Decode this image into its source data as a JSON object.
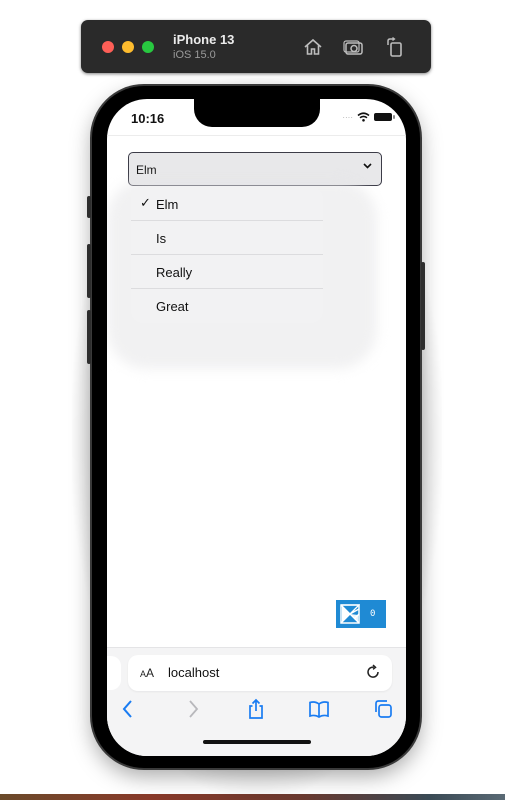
{
  "simulator": {
    "device_name": "iPhone 13",
    "os_version": "iOS 15.0",
    "buttons": [
      {
        "name": "home",
        "icon": "home-icon"
      },
      {
        "name": "screenshot",
        "icon": "camera-icon"
      },
      {
        "name": "rotate",
        "icon": "rotate-icon"
      }
    ]
  },
  "status_bar": {
    "time": "10:16",
    "signal": "····",
    "icons": [
      "wifi-icon",
      "battery-icon"
    ]
  },
  "select": {
    "value": "Elm",
    "chevron": "⌄",
    "options": [
      {
        "label": "Elm",
        "selected": true,
        "check": "✓"
      },
      {
        "label": "Is",
        "selected": false,
        "check": ""
      },
      {
        "label": "Really",
        "selected": false,
        "check": ""
      },
      {
        "label": "Great",
        "selected": false,
        "check": ""
      }
    ]
  },
  "elm_debugger": {
    "message_count": "0",
    "color": "#1f8ad4"
  },
  "safari": {
    "text_size_label_small": "A",
    "text_size_label_large": "A",
    "url": "localhost",
    "toolbar": [
      "back-icon",
      "forward-icon",
      "share-icon",
      "bookmarks-icon",
      "tabs-icon"
    ],
    "accent": "#1a7cf2"
  }
}
